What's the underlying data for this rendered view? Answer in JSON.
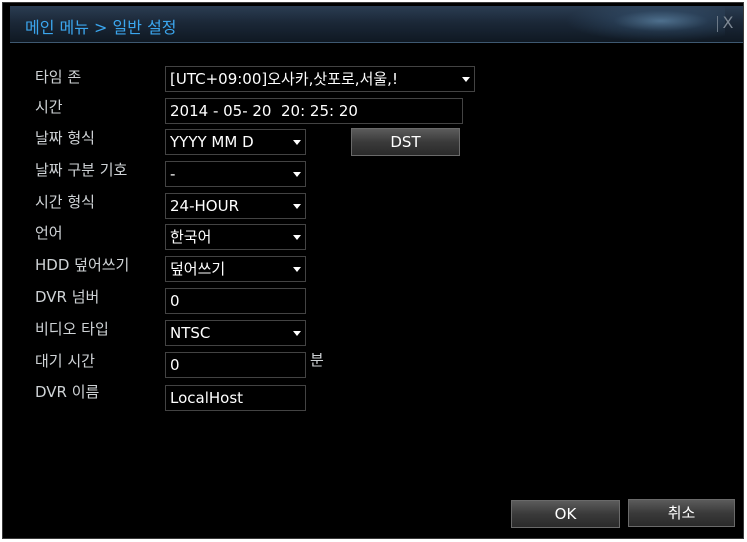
{
  "dialog": {
    "title": "메인 메뉴 > 일반 설정",
    "close_label": "X"
  },
  "settings": {
    "timezone": {
      "label": "타임 존",
      "value": "[UTC+09:00]오사카,삿포로,서울,!"
    },
    "time": {
      "label": "시간",
      "value": "2014 - 05- 20  20: 25: 20"
    },
    "date_format": {
      "label": "날짜 형식",
      "value": "YYYY MM D"
    },
    "dst_button": "DST",
    "date_separator": {
      "label": "날짜 구분 기호",
      "value": "-"
    },
    "time_format": {
      "label": "시간 형식",
      "value": "24-HOUR"
    },
    "language": {
      "label": "언어",
      "value": "한국어"
    },
    "hdd_overwrite": {
      "label": "HDD 덮어쓰기",
      "value": "덮어쓰기"
    },
    "dvr_number": {
      "label": "DVR 넘버",
      "value": "0"
    },
    "video_type": {
      "label": "비디오 타입",
      "value": "NTSC"
    },
    "standby_time": {
      "label": "대기 시간",
      "value": "0",
      "unit": "분"
    },
    "dvr_name": {
      "label": "DVR 이름",
      "value": "LocalHost"
    }
  },
  "footer": {
    "ok_label": "OK",
    "cancel_label": "취소"
  }
}
